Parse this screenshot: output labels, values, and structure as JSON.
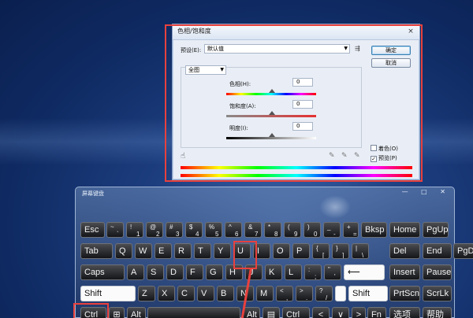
{
  "dialog": {
    "title": "色相/饱和度",
    "close": "×",
    "preset_label": "预设(E):",
    "preset_value": "默认值",
    "ok": "确定",
    "cancel": "取消",
    "channel": "全图",
    "hue_label": "色相(H):",
    "hue_value": "0",
    "saturation_label": "饱和度(A):",
    "saturation_value": "0",
    "lightness_label": "明度(I):",
    "lightness_value": "0",
    "colorize_label": "着色(O)",
    "colorize_checked": false,
    "preview_label": "预览(P)",
    "preview_checked": true
  },
  "osk": {
    "title": "屏幕键盘",
    "controls": "— □ ✕",
    "row1": [
      "Esc",
      "~ `",
      "! 1",
      "@ 2",
      "# 3",
      "$ 4",
      "% 5",
      "^ 6",
      "& 7",
      "* 8",
      "( 9",
      ") 0",
      "_ -",
      "+ =",
      "Bksp",
      "Home",
      "PgUp"
    ],
    "row2": [
      "Tab",
      "Q",
      "W",
      "E",
      "R",
      "T",
      "Y",
      "U",
      "I",
      "O",
      "P",
      "{ [",
      "} ]",
      "| \\",
      "Del",
      "End",
      "PgDn"
    ],
    "row3": [
      "Caps",
      "A",
      "S",
      "D",
      "F",
      "G",
      "H",
      "J",
      "K",
      "L",
      ": ;",
      "\" '",
      "⟵",
      "Insert",
      "Pause"
    ],
    "row4": [
      "Shift",
      "Z",
      "X",
      "C",
      "V",
      "B",
      "N",
      "M",
      "< ,",
      "> .",
      "? /",
      "",
      "Shift",
      "PrtScn",
      "ScrLk"
    ],
    "row5": [
      "Ctrl",
      "⊞",
      "Alt",
      "",
      "Alt",
      "▤",
      "Ctrl",
      "<",
      "∨",
      ">",
      "Fn",
      "选项",
      "帮助"
    ]
  },
  "colors": {
    "highlight": "#e8413d"
  }
}
